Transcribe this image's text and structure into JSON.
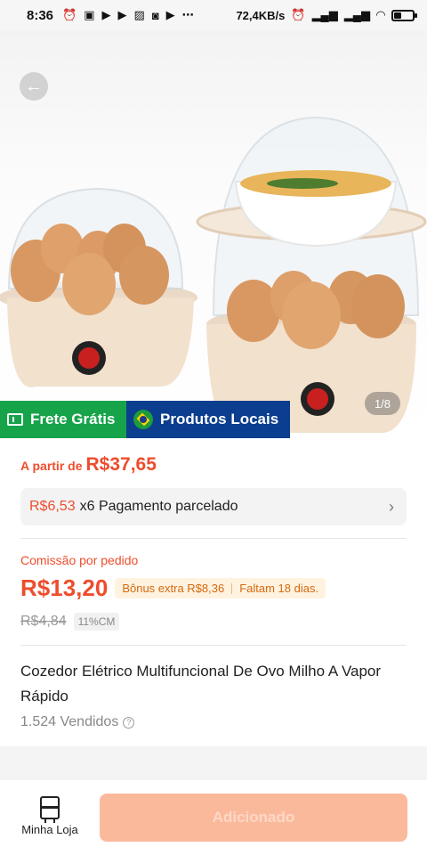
{
  "status_bar": {
    "time": "8:36",
    "network_speed": "72,4KB/s"
  },
  "hero": {
    "image_counter": "1/8",
    "badges": [
      {
        "label": "Frete Grátis",
        "color": "#16a34a"
      },
      {
        "label": "Produtos Locais",
        "color": "#0b3e8f"
      }
    ]
  },
  "pricing": {
    "from_label": "A partir de",
    "from_price": "R$37,65",
    "installment_amount": "R$6,53",
    "installment_text": "x6 Pagamento parcelado"
  },
  "commission": {
    "label": "Comissão por pedido",
    "value": "R$13,20",
    "bonus": "Bônus extra R$8,36",
    "days_left": "Faltam 18 dias.",
    "old_value": "R$4,84",
    "rate": "11%CM"
  },
  "product": {
    "title": "Cozedor Elétrico Multifuncional De Ovo Milho A Vapor Rápido",
    "sold": "1.524 Vendidos"
  },
  "bottom_bar": {
    "store_label": "Minha Loja",
    "add_button_label": "Adicionado"
  },
  "colors": {
    "accent": "#ee4d2d",
    "button_disabled": "#fbb99c"
  }
}
